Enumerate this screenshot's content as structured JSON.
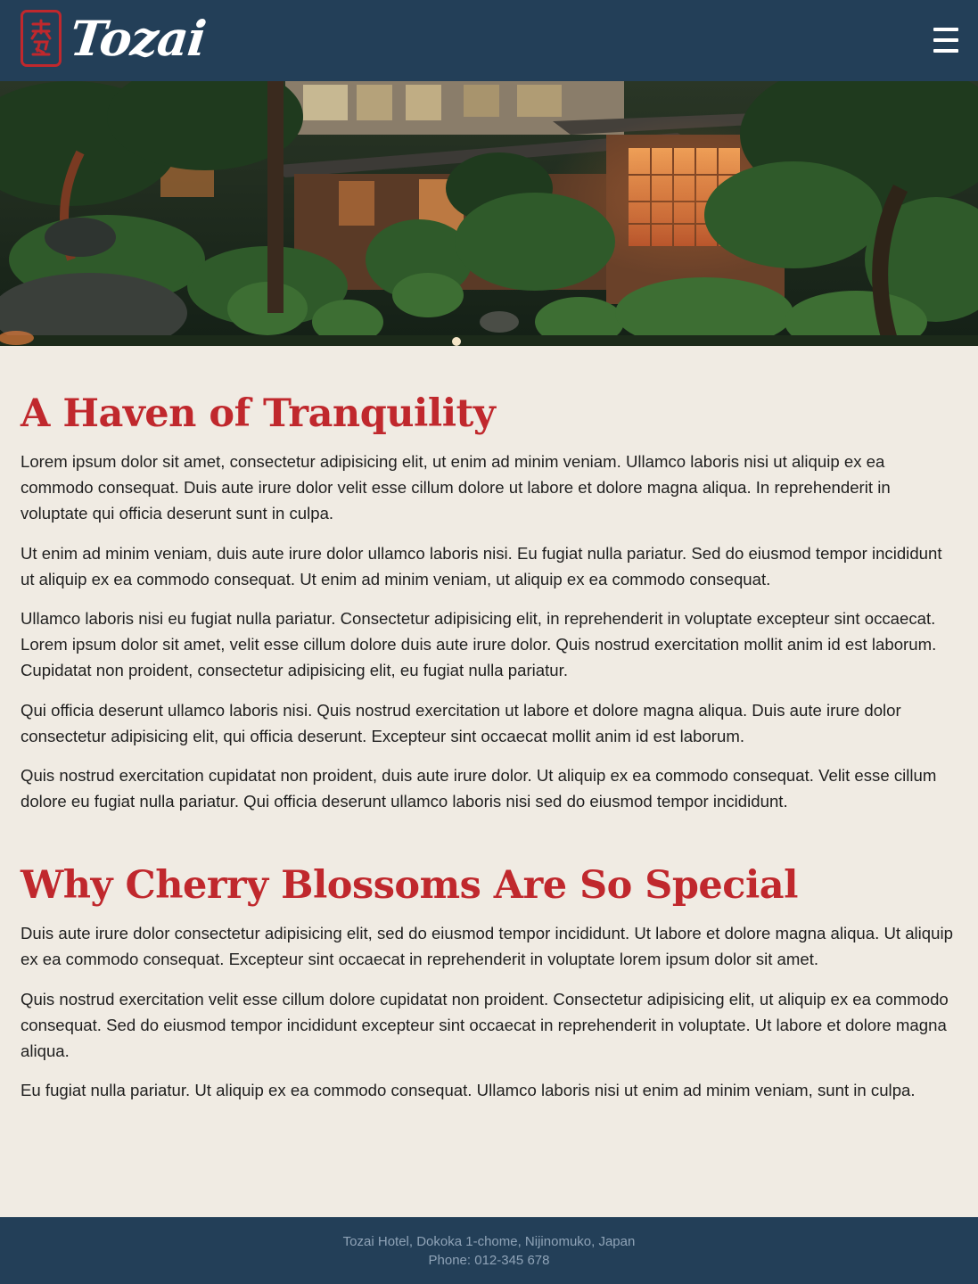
{
  "header": {
    "brand_name": "Tozai",
    "menu_icon": "hamburger-menu-icon"
  },
  "hero": {
    "description_icon": "japanese-garden-image"
  },
  "sections": [
    {
      "heading": "A Haven of Tranquility",
      "paragraphs": [
        "Lorem ipsum dolor sit amet, consectetur adipisicing elit, ut enim ad minim veniam. Ullamco laboris nisi ut aliquip ex ea commodo consequat. Duis aute irure dolor velit esse cillum dolore ut labore et dolore magna aliqua. In reprehenderit in voluptate qui officia deserunt sunt in culpa.",
        "Ut enim ad minim veniam, duis aute irure dolor ullamco laboris nisi. Eu fugiat nulla pariatur. Sed do eiusmod tempor incididunt ut aliquip ex ea commodo consequat. Ut enim ad minim veniam, ut aliquip ex ea commodo consequat.",
        "Ullamco laboris nisi eu fugiat nulla pariatur. Consectetur adipisicing elit, in reprehenderit in voluptate excepteur sint occaecat. Lorem ipsum dolor sit amet, velit esse cillum dolore duis aute irure dolor. Quis nostrud exercitation mollit anim id est laborum. Cupidatat non proident, consectetur adipisicing elit, eu fugiat nulla pariatur.",
        "Qui officia deserunt ullamco laboris nisi. Quis nostrud exercitation ut labore et dolore magna aliqua. Duis aute irure dolor consectetur adipisicing elit, qui officia deserunt. Excepteur sint occaecat mollit anim id est laborum.",
        "Quis nostrud exercitation cupidatat non proident, duis aute irure dolor. Ut aliquip ex ea commodo consequat. Velit esse cillum dolore eu fugiat nulla pariatur. Qui officia deserunt ullamco laboris nisi sed do eiusmod tempor incididunt."
      ]
    },
    {
      "heading": "Why Cherry Blossoms Are So Special",
      "paragraphs": [
        "Duis aute irure dolor consectetur adipisicing elit, sed do eiusmod tempor incididunt. Ut labore et dolore magna aliqua. Ut aliquip ex ea commodo consequat. Excepteur sint occaecat in reprehenderit in voluptate lorem ipsum dolor sit amet.",
        "Quis nostrud exercitation velit esse cillum dolore cupidatat non proident. Consectetur adipisicing elit, ut aliquip ex ea commodo consequat. Sed do eiusmod tempor incididunt excepteur sint occaecat in reprehenderit in voluptate. Ut labore et dolore magna aliqua.",
        "Eu fugiat nulla pariatur. Ut aliquip ex ea commodo consequat. Ullamco laboris nisi ut enim ad minim veniam, sunt in culpa."
      ]
    }
  ],
  "footer": {
    "address": "Tozai Hotel, Dokoka 1-chome, Nijinomuko, Japan",
    "phone": "Phone: 012-345 678"
  },
  "colors": {
    "header_bg": "#233f58",
    "accent_red": "#c0282d",
    "page_bg": "#f0ebe3",
    "footer_text": "#8fa3b7"
  }
}
